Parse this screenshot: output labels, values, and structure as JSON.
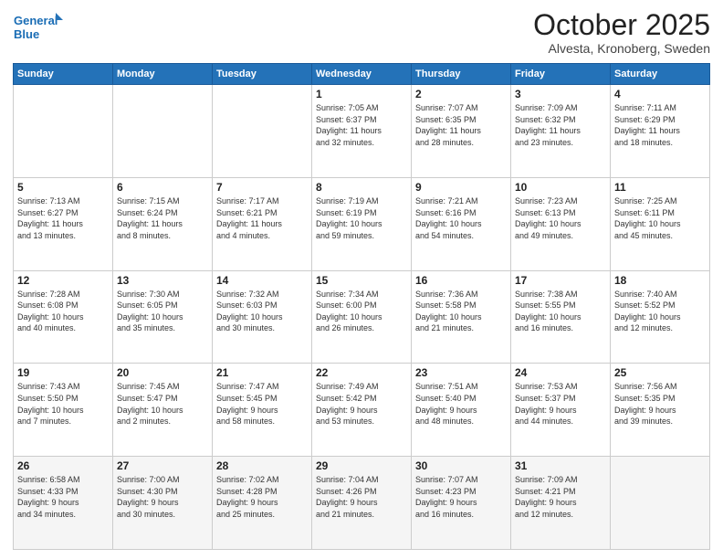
{
  "header": {
    "logo_line1": "General",
    "logo_line2": "Blue",
    "month": "October 2025",
    "location": "Alvesta, Kronoberg, Sweden"
  },
  "weekdays": [
    "Sunday",
    "Monday",
    "Tuesday",
    "Wednesday",
    "Thursday",
    "Friday",
    "Saturday"
  ],
  "weeks": [
    [
      {
        "day": "",
        "info": ""
      },
      {
        "day": "",
        "info": ""
      },
      {
        "day": "",
        "info": ""
      },
      {
        "day": "1",
        "info": "Sunrise: 7:05 AM\nSunset: 6:37 PM\nDaylight: 11 hours\nand 32 minutes."
      },
      {
        "day": "2",
        "info": "Sunrise: 7:07 AM\nSunset: 6:35 PM\nDaylight: 11 hours\nand 28 minutes."
      },
      {
        "day": "3",
        "info": "Sunrise: 7:09 AM\nSunset: 6:32 PM\nDaylight: 11 hours\nand 23 minutes."
      },
      {
        "day": "4",
        "info": "Sunrise: 7:11 AM\nSunset: 6:29 PM\nDaylight: 11 hours\nand 18 minutes."
      }
    ],
    [
      {
        "day": "5",
        "info": "Sunrise: 7:13 AM\nSunset: 6:27 PM\nDaylight: 11 hours\nand 13 minutes."
      },
      {
        "day": "6",
        "info": "Sunrise: 7:15 AM\nSunset: 6:24 PM\nDaylight: 11 hours\nand 8 minutes."
      },
      {
        "day": "7",
        "info": "Sunrise: 7:17 AM\nSunset: 6:21 PM\nDaylight: 11 hours\nand 4 minutes."
      },
      {
        "day": "8",
        "info": "Sunrise: 7:19 AM\nSunset: 6:19 PM\nDaylight: 10 hours\nand 59 minutes."
      },
      {
        "day": "9",
        "info": "Sunrise: 7:21 AM\nSunset: 6:16 PM\nDaylight: 10 hours\nand 54 minutes."
      },
      {
        "day": "10",
        "info": "Sunrise: 7:23 AM\nSunset: 6:13 PM\nDaylight: 10 hours\nand 49 minutes."
      },
      {
        "day": "11",
        "info": "Sunrise: 7:25 AM\nSunset: 6:11 PM\nDaylight: 10 hours\nand 45 minutes."
      }
    ],
    [
      {
        "day": "12",
        "info": "Sunrise: 7:28 AM\nSunset: 6:08 PM\nDaylight: 10 hours\nand 40 minutes."
      },
      {
        "day": "13",
        "info": "Sunrise: 7:30 AM\nSunset: 6:05 PM\nDaylight: 10 hours\nand 35 minutes."
      },
      {
        "day": "14",
        "info": "Sunrise: 7:32 AM\nSunset: 6:03 PM\nDaylight: 10 hours\nand 30 minutes."
      },
      {
        "day": "15",
        "info": "Sunrise: 7:34 AM\nSunset: 6:00 PM\nDaylight: 10 hours\nand 26 minutes."
      },
      {
        "day": "16",
        "info": "Sunrise: 7:36 AM\nSunset: 5:58 PM\nDaylight: 10 hours\nand 21 minutes."
      },
      {
        "day": "17",
        "info": "Sunrise: 7:38 AM\nSunset: 5:55 PM\nDaylight: 10 hours\nand 16 minutes."
      },
      {
        "day": "18",
        "info": "Sunrise: 7:40 AM\nSunset: 5:52 PM\nDaylight: 10 hours\nand 12 minutes."
      }
    ],
    [
      {
        "day": "19",
        "info": "Sunrise: 7:43 AM\nSunset: 5:50 PM\nDaylight: 10 hours\nand 7 minutes."
      },
      {
        "day": "20",
        "info": "Sunrise: 7:45 AM\nSunset: 5:47 PM\nDaylight: 10 hours\nand 2 minutes."
      },
      {
        "day": "21",
        "info": "Sunrise: 7:47 AM\nSunset: 5:45 PM\nDaylight: 9 hours\nand 58 minutes."
      },
      {
        "day": "22",
        "info": "Sunrise: 7:49 AM\nSunset: 5:42 PM\nDaylight: 9 hours\nand 53 minutes."
      },
      {
        "day": "23",
        "info": "Sunrise: 7:51 AM\nSunset: 5:40 PM\nDaylight: 9 hours\nand 48 minutes."
      },
      {
        "day": "24",
        "info": "Sunrise: 7:53 AM\nSunset: 5:37 PM\nDaylight: 9 hours\nand 44 minutes."
      },
      {
        "day": "25",
        "info": "Sunrise: 7:56 AM\nSunset: 5:35 PM\nDaylight: 9 hours\nand 39 minutes."
      }
    ],
    [
      {
        "day": "26",
        "info": "Sunrise: 6:58 AM\nSunset: 4:33 PM\nDaylight: 9 hours\nand 34 minutes."
      },
      {
        "day": "27",
        "info": "Sunrise: 7:00 AM\nSunset: 4:30 PM\nDaylight: 9 hours\nand 30 minutes."
      },
      {
        "day": "28",
        "info": "Sunrise: 7:02 AM\nSunset: 4:28 PM\nDaylight: 9 hours\nand 25 minutes."
      },
      {
        "day": "29",
        "info": "Sunrise: 7:04 AM\nSunset: 4:26 PM\nDaylight: 9 hours\nand 21 minutes."
      },
      {
        "day": "30",
        "info": "Sunrise: 7:07 AM\nSunset: 4:23 PM\nDaylight: 9 hours\nand 16 minutes."
      },
      {
        "day": "31",
        "info": "Sunrise: 7:09 AM\nSunset: 4:21 PM\nDaylight: 9 hours\nand 12 minutes."
      },
      {
        "day": "",
        "info": ""
      }
    ]
  ]
}
